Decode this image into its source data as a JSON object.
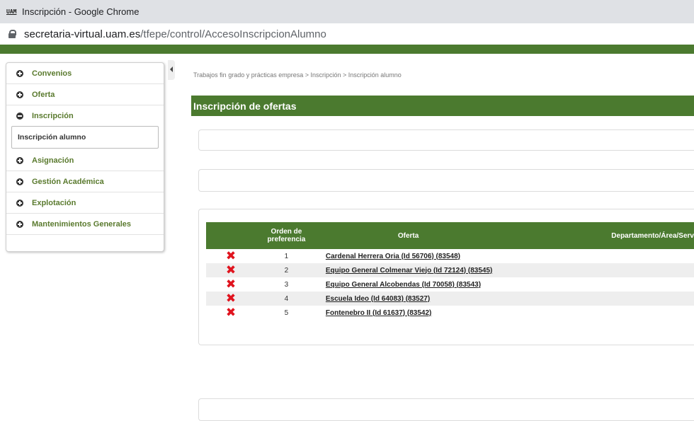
{
  "window": {
    "favicon_text": "UAM",
    "title": "Inscripción - Google Chrome"
  },
  "address_bar": {
    "host": "secretaria-virtual.uam.es",
    "path": "/tfepe/control/AccesoInscripcionAlumno"
  },
  "sidebar": {
    "items": [
      {
        "label": "Convenios",
        "state": "collapsed"
      },
      {
        "label": "Oferta",
        "state": "collapsed"
      },
      {
        "label": "Inscripción",
        "state": "expanded"
      },
      {
        "label": "Asignación",
        "state": "collapsed"
      },
      {
        "label": "Gestión Académica",
        "state": "collapsed"
      },
      {
        "label": "Explotación",
        "state": "collapsed"
      },
      {
        "label": "Mantenimientos Generales",
        "state": "collapsed"
      }
    ],
    "submenu": {
      "label": "Inscripción alumno"
    }
  },
  "breadcrumb": "Trabajos fin grado y prácticas empresa > Inscripción > Inscripción alumno",
  "section_title": "Inscripción de ofertas",
  "table": {
    "headers": {
      "order": "Orden de preferencia",
      "offer": "Oferta",
      "department": "Departamento/Área/Serv"
    },
    "rows": [
      {
        "order": "1",
        "offer": "Cardenal Herrera Oria (Id 56706) (83548)"
      },
      {
        "order": "2",
        "offer": "Equipo General Colmenar Viejo (Id 72124) (83545)"
      },
      {
        "order": "3",
        "offer": "Equipo General Alcobendas (Id 70058) (83543)"
      },
      {
        "order": "4",
        "offer": "Escuela Ideo (Id 64083) (83527)"
      },
      {
        "order": "5",
        "offer": "Fontenebro II (Id 61637) (83542)"
      }
    ],
    "delete_glyph": "✖"
  },
  "colors": {
    "brand_green": "#4b7a2f",
    "delete_red": "#e0141e"
  },
  "icons": {
    "collapsed": "plus-circle-icon",
    "expanded": "minus-circle-icon",
    "delete": "delete-x-icon"
  }
}
